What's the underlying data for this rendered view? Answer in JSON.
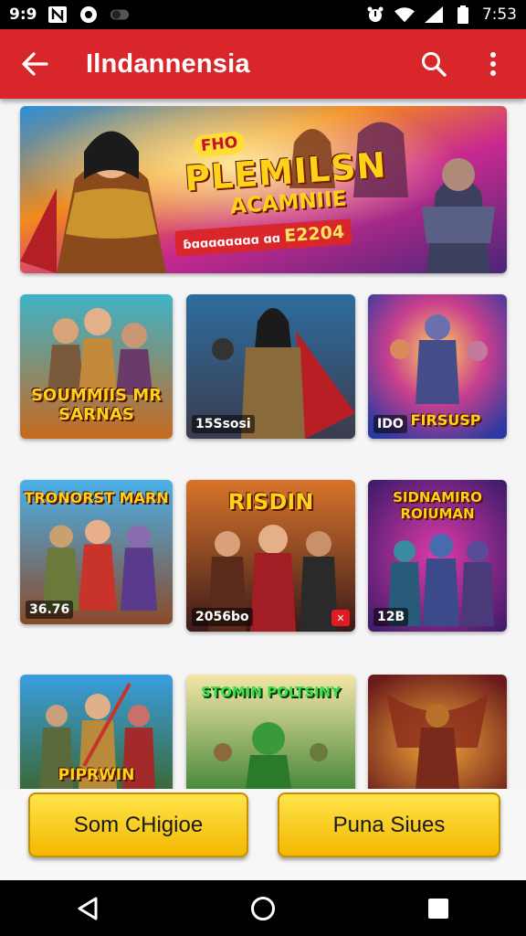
{
  "status_bar": {
    "time": "9:9",
    "clock": "7:53",
    "icons": [
      "notification-n-icon",
      "circle-app-icon",
      "toggle-icon",
      "alarm-icon",
      "wifi-icon",
      "signal-icon",
      "battery-icon"
    ]
  },
  "app_bar": {
    "title": "Ilndannensia",
    "back_icon": "arrow-left-icon",
    "search_icon": "search-icon",
    "more_icon": "more-vertical-icon",
    "color": "#d8262b"
  },
  "banner": {
    "tag": "FHO",
    "headline": "PLEMILSN",
    "subheadline": "ACAMNIIE",
    "strip_text": "ɓɑɑɑɑɑɑɑɑ ɑɑ",
    "strip_number": "E2204"
  },
  "tiles": [
    {
      "title": "SOUMMIIS MR SARNAS",
      "badge": "",
      "has_x": false
    },
    {
      "title": "",
      "badge": "15Ssosi",
      "has_x": false
    },
    {
      "title": "FIRSUSP",
      "badge": "IDO",
      "has_x": false
    },
    {
      "title": "TRONORST MARN",
      "badge": "36.76",
      "has_x": false
    },
    {
      "title": "RISDIN",
      "badge": "2056bo",
      "has_x": true
    },
    {
      "title": "SIDNAMIRO ROIUMAN",
      "badge": "12B",
      "has_x": false
    },
    {
      "title": "PIPRWIN",
      "badge": "",
      "has_x": false
    },
    {
      "title": "STOMIN POLTSINY",
      "badge": "",
      "has_x": false
    },
    {
      "title": "",
      "badge": "",
      "has_x": false
    }
  ],
  "buttons": {
    "left_label": "Som CHigioe",
    "right_label": "Puna Siues",
    "accent": "#f7cc14"
  },
  "nav": {
    "back_icon": "triangle-back-icon",
    "home_icon": "circle-home-icon",
    "recents_icon": "square-recents-icon"
  }
}
